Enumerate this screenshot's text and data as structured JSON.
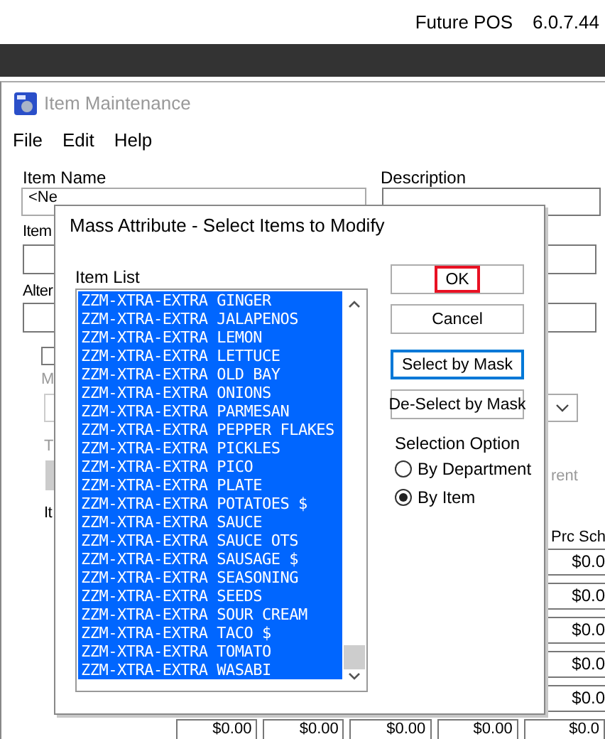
{
  "top_bar": {
    "app_name": "Future POS",
    "version": "6.0.7.44"
  },
  "window": {
    "title": "Item Maintenance"
  },
  "menu": [
    "File",
    "Edit",
    "Help"
  ],
  "form": {
    "item_name_label": "Item Name",
    "item_name_value": "<Ne",
    "description_label": "Description",
    "item_label": "Item",
    "alternate_label": "Alter",
    "checkbox": {
      "checked": false
    },
    "m_label": "M",
    "t_label": "T",
    "it_label": "It",
    "right_label": "rent",
    "price_schedule_label": "Prc Sch",
    "price_cells": [
      "$0.0",
      "$0.0",
      "$0.0",
      "$0.0",
      "$0.0"
    ],
    "bottom_cells": [
      "$0.00",
      "$0.00",
      "$0.00",
      "$0.00",
      "$0.0"
    ]
  },
  "dialog": {
    "title": "Mass Attribute - Select Items to Modify",
    "list_label": "Item List",
    "items": [
      {
        "name": "ZZM-XTRA-EXTRA GINGER",
        "selected": true
      },
      {
        "name": "ZZM-XTRA-EXTRA JALAPENOS",
        "selected": true
      },
      {
        "name": "ZZM-XTRA-EXTRA LEMON",
        "selected": true
      },
      {
        "name": "ZZM-XTRA-EXTRA LETTUCE",
        "selected": true
      },
      {
        "name": "ZZM-XTRA-EXTRA OLD BAY",
        "selected": true
      },
      {
        "name": "ZZM-XTRA-EXTRA ONIONS",
        "selected": true
      },
      {
        "name": "ZZM-XTRA-EXTRA PARMESAN",
        "selected": true
      },
      {
        "name": "ZZM-XTRA-EXTRA PEPPER FLAKES",
        "selected": true
      },
      {
        "name": "ZZM-XTRA-EXTRA PICKLES",
        "selected": true
      },
      {
        "name": "ZZM-XTRA-EXTRA PICO",
        "selected": true
      },
      {
        "name": "ZZM-XTRA-EXTRA PLATE",
        "selected": true
      },
      {
        "name": "ZZM-XTRA-EXTRA POTATOES $",
        "selected": true
      },
      {
        "name": "ZZM-XTRA-EXTRA SAUCE",
        "selected": true
      },
      {
        "name": "ZZM-XTRA-EXTRA SAUCE OTS",
        "selected": true
      },
      {
        "name": "ZZM-XTRA-EXTRA SAUSAGE $",
        "selected": true
      },
      {
        "name": "ZZM-XTRA-EXTRA SEASONING",
        "selected": true
      },
      {
        "name": "ZZM-XTRA-EXTRA SEEDS",
        "selected": true
      },
      {
        "name": "ZZM-XTRA-EXTRA SOUR CREAM",
        "selected": true
      },
      {
        "name": "ZZM-XTRA-EXTRA TACO $",
        "selected": true
      },
      {
        "name": "ZZM-XTRA-EXTRA TOMATO",
        "selected": true
      },
      {
        "name": "ZZM-XTRA-EXTRA WASABI",
        "selected": true
      }
    ],
    "buttons": [
      {
        "label": "OK",
        "marked": true,
        "default": false
      },
      {
        "label": "Cancel",
        "marked": false,
        "default": false
      },
      {
        "label": "Select by Mask",
        "marked": false,
        "default": true
      },
      {
        "label": "De-Select by Mask",
        "marked": false,
        "default": false
      }
    ],
    "selection_option": {
      "label": "Selection Option",
      "options": [
        {
          "label": "By Department",
          "selected": false
        },
        {
          "label": "By Item",
          "selected": true
        }
      ]
    }
  }
}
